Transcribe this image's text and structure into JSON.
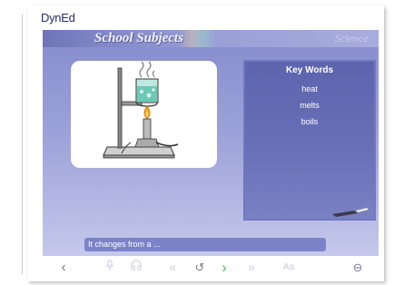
{
  "brand": {
    "logo_dyn": "Dyn",
    "logo_ed": "Ed"
  },
  "header": {
    "title": "School Subjects",
    "subject": "Science"
  },
  "key_words": {
    "title": "Key Words",
    "items": [
      "heat",
      "melts",
      "boils"
    ]
  },
  "caption": {
    "text": "It changes from a ..."
  },
  "toolbar": {
    "back_glyph": "‹",
    "rewind_glyph": "«",
    "replay_glyph": "↺",
    "forward_glyph": "›",
    "fastforward_glyph": "»",
    "text_toggle_label": "Aa",
    "exit_glyph": "⊖"
  },
  "colors": {
    "accent_panel": "#5d64ad",
    "stage_top": "#8a90cf",
    "caption_bg": "#7c82c8",
    "next_green": "#4ec46a"
  },
  "icons": [
    "back-icon",
    "microphone-icon",
    "headphones-icon",
    "rewind-icon",
    "replay-icon",
    "forward-icon",
    "fast-forward-icon",
    "text-toggle-icon",
    "exit-icon"
  ]
}
